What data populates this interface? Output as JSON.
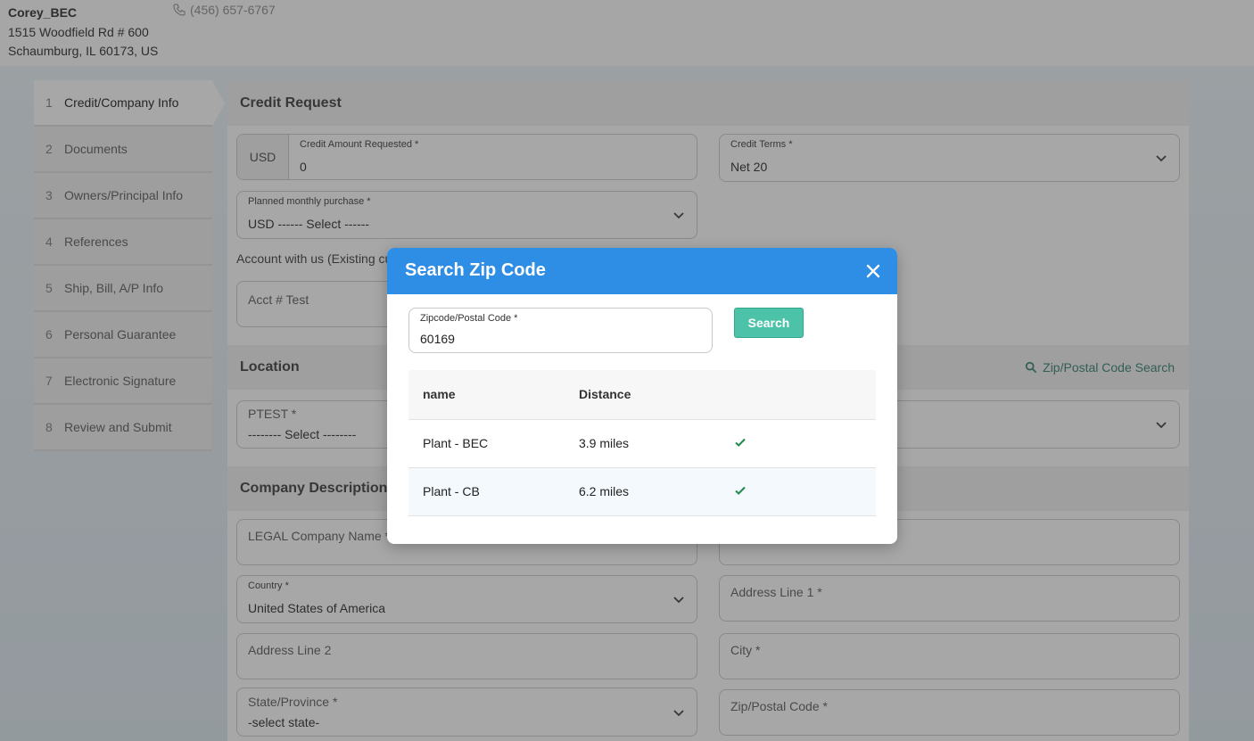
{
  "header": {
    "company_name": "Corey_BEC",
    "address_line1": "1515 Woodfield Rd # 600",
    "address_line2": "Schaumburg, IL 60173, US",
    "phone": "(456) 657-6767"
  },
  "steps": [
    {
      "num": "1",
      "label": "Credit/Company Info"
    },
    {
      "num": "2",
      "label": "Documents"
    },
    {
      "num": "3",
      "label": "Owners/Principal Info"
    },
    {
      "num": "4",
      "label": "References"
    },
    {
      "num": "5",
      "label": "Ship, Bill, A/P Info"
    },
    {
      "num": "6",
      "label": "Personal Guarantee"
    },
    {
      "num": "7",
      "label": "Electronic Signature"
    },
    {
      "num": "8",
      "label": "Review and Submit"
    }
  ],
  "credit": {
    "title": "Credit Request",
    "currency": "USD",
    "amount_label": "Credit Amount Requested  *",
    "amount_value": "0",
    "terms_label": "Credit Terms  *",
    "terms_value": "Net 20",
    "monthly_label": "Planned monthly purchase  *",
    "monthly_value": "USD ------ Select ------",
    "account_text": "Account with us (Existing cu",
    "acct_placeholder": "Acct # Test"
  },
  "location": {
    "title": "Location",
    "zip_search_link": "Zip/Postal Code Search",
    "ptest_label": "PTEST  *",
    "ptest_value": "-------- Select --------"
  },
  "company": {
    "title": "Company Description",
    "legal_name_label": "LEGAL Company Name  *",
    "country_label": "Country  *",
    "country_value": "United States of America",
    "address1_label": "Address Line 1  *",
    "address2_label": "Address Line 2",
    "city_label": "City  *",
    "state_label": "State/Province  *",
    "state_value": "-select state-",
    "zip_label": "Zip/Postal Code  *"
  },
  "modal": {
    "title": "Search Zip Code",
    "zip_label": "Zipcode/Postal Code  *",
    "zip_value": "60169",
    "search_button": "Search",
    "columns": [
      "name",
      "Distance"
    ],
    "rows": [
      {
        "name": "Plant - BEC",
        "distance": "3.9 miles"
      },
      {
        "name": "Plant - CB",
        "distance": "6.2 miles"
      }
    ]
  },
  "colors": {
    "modal_header": "#2e8de4",
    "search_button": "#4cc3a8",
    "check": "#1f8a4c",
    "link": "#2a7a6b"
  }
}
